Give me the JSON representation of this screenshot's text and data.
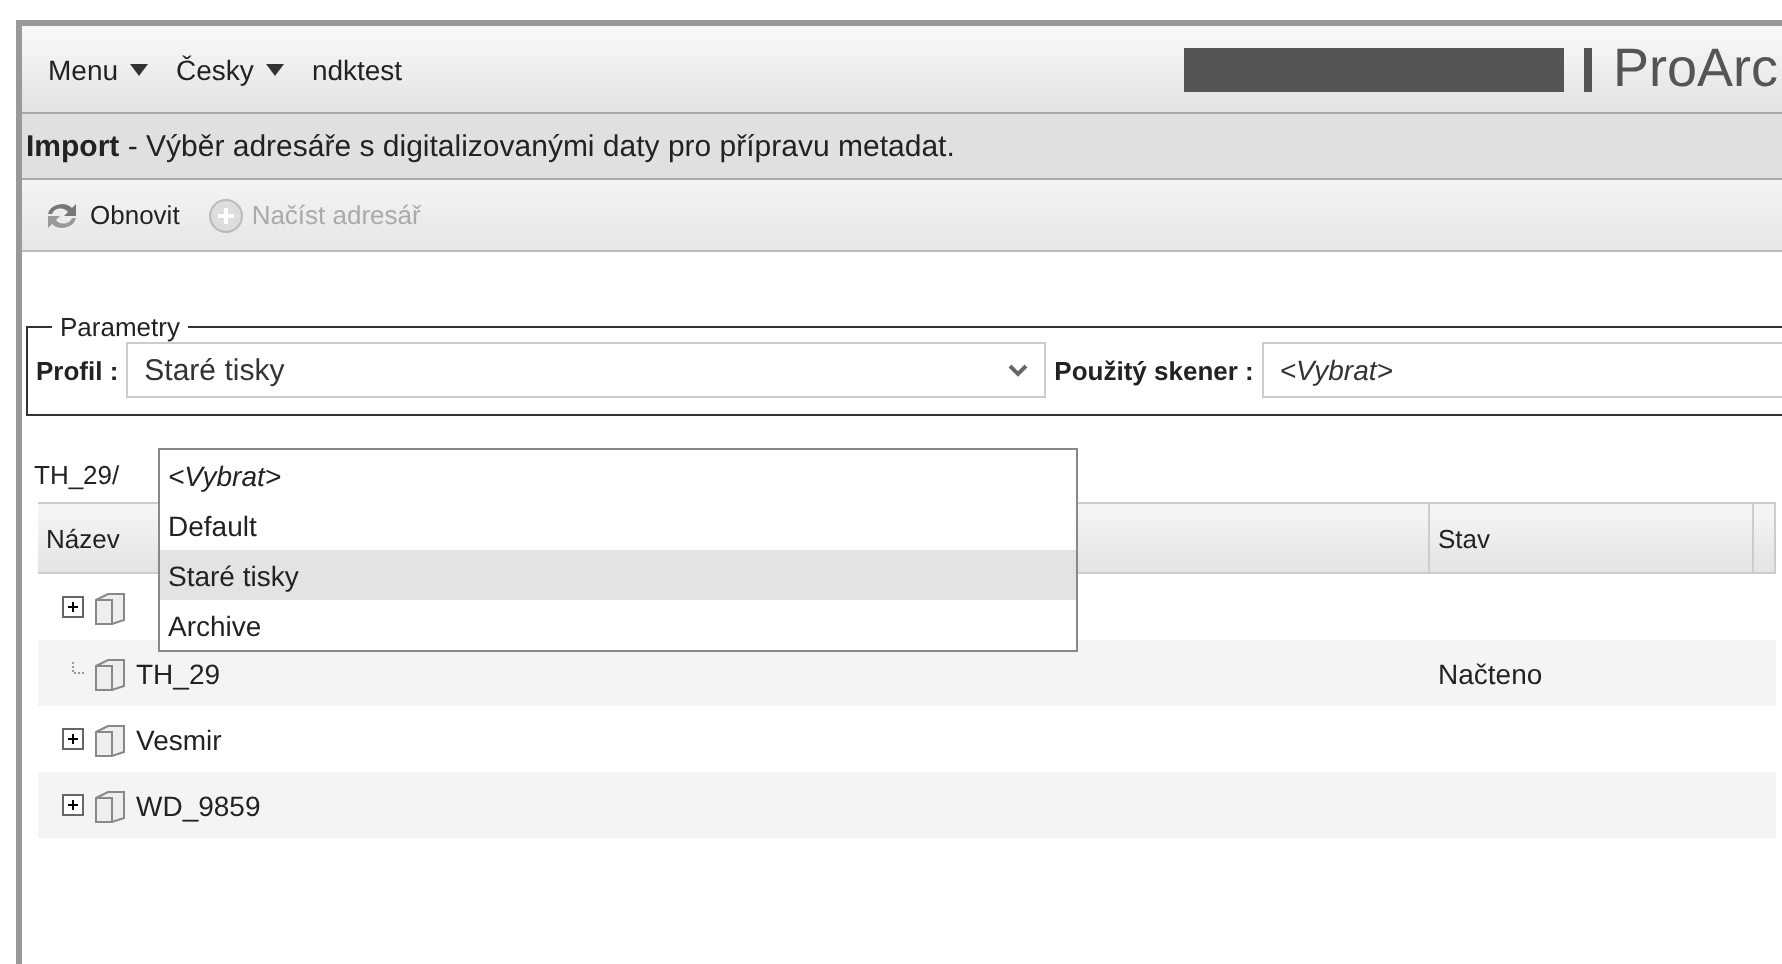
{
  "header": {
    "menus": [
      {
        "label": "Menu",
        "dropdown": true
      },
      {
        "label": "Česky",
        "dropdown": true
      },
      {
        "label": "ndktest",
        "dropdown": false
      }
    ],
    "brand": "ProArc"
  },
  "title_bar": {
    "text": "**Import** - Výběr adresáře s digitalizovanými daty pro přípravu metadat."
  },
  "toolbar": [
    {
      "label": "Obnovit",
      "disabled": false
    },
    {
      "label": "Načíst adresář",
      "disabled": true
    }
  ],
  "parameters": {
    "legend": "Parametry",
    "profile_label": "Profil :",
    "profile_value": "Staré tisky",
    "scanner_label": "Použitý skener :",
    "scanner_value": "<Vybrat>"
  },
  "path": "TH_29/",
  "profile_dropdown": [
    {
      "label": "<Vybrat>",
      "italic": true,
      "selected": false
    },
    {
      "label": "Default",
      "italic": false,
      "selected": false
    },
    {
      "label": "Staré tisky",
      "italic": false,
      "selected": true
    },
    {
      "label": "Archive",
      "italic": false,
      "selected": false
    }
  ],
  "table": {
    "columns": [
      "Název",
      "Stav"
    ],
    "rows": [
      {
        "expandable": true
      },
      {
        "name": "TH_29",
        "status": "Načteno",
        "expandable": false
      },
      {
        "name": "Vesmir",
        "expandable": true
      },
      {
        "name": "WD_9859",
        "expandable": true
      }
    ]
  }
}
